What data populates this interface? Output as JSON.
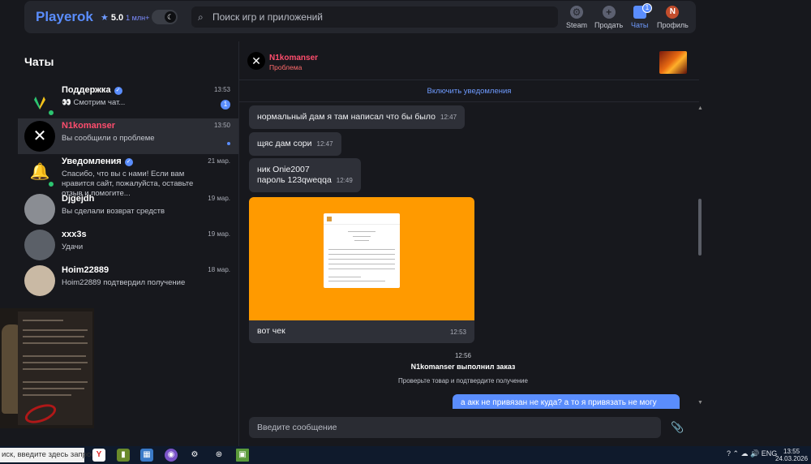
{
  "header": {
    "brand": "Playerok",
    "rating": "5.0",
    "users": "1 млн+",
    "search_placeholder": "Поиск игр и приложений",
    "nav": [
      {
        "label": "Steam",
        "icon": "steam-icon"
      },
      {
        "label": "Продать",
        "icon": "plus-icon"
      },
      {
        "label": "Чаты",
        "icon": "chat-icon",
        "badge": "1"
      },
      {
        "label": "Профиль",
        "icon": "avatar",
        "initial": "N"
      }
    ]
  },
  "sidebar": {
    "title": "Чаты",
    "items": [
      {
        "name": "Поддержка",
        "time": "13:53",
        "preview": "👀 Смотрим чат...",
        "unread": "1"
      },
      {
        "name": "N1komanser",
        "time": "13:50",
        "preview": "Вы сообщили о проблеме"
      },
      {
        "name": "Уведомления",
        "time": "21 мар.",
        "preview": "Спасибо, что вы с нами! Если вам нравится сайт, пожалуйста, оставьте отзыв и помогите..."
      },
      {
        "name": "Djgejdh",
        "time": "19 мар.",
        "preview": "Вы сделали возврат средств"
      },
      {
        "name": "xxx3s",
        "time": "19 мар.",
        "preview": "Удачи"
      },
      {
        "name": "Hoim22889",
        "time": "18 мар.",
        "preview": "Hoim22889 подтвердил получение"
      }
    ]
  },
  "conversation": {
    "name": "N1komanser",
    "status": "Проблема",
    "enable_notifications": "Включить уведомления",
    "messages": [
      {
        "text": "нормальный дам я там написал что бы было",
        "time": "12:47"
      },
      {
        "text": "щяс дам сори",
        "time": "12:47"
      },
      {
        "line1": "ник Onie2007",
        "line2": "пароль 123qweqqa",
        "time": "12:49"
      },
      {
        "caption": "вот чек",
        "time": "12:53"
      }
    ],
    "system": {
      "time": "12:56",
      "title": "N1komanser выполнил заказ",
      "subtitle": "Проверьте товар и подтвердите получение"
    },
    "my_message": "а акк не привязан не куда? а то я привязать не могу",
    "composer_placeholder": "Введите сообщение"
  },
  "taskbar": {
    "search_text": "иск, введите здесь запрос",
    "lang": "ENG",
    "time": "13:55",
    "date": "24.03.2026"
  }
}
